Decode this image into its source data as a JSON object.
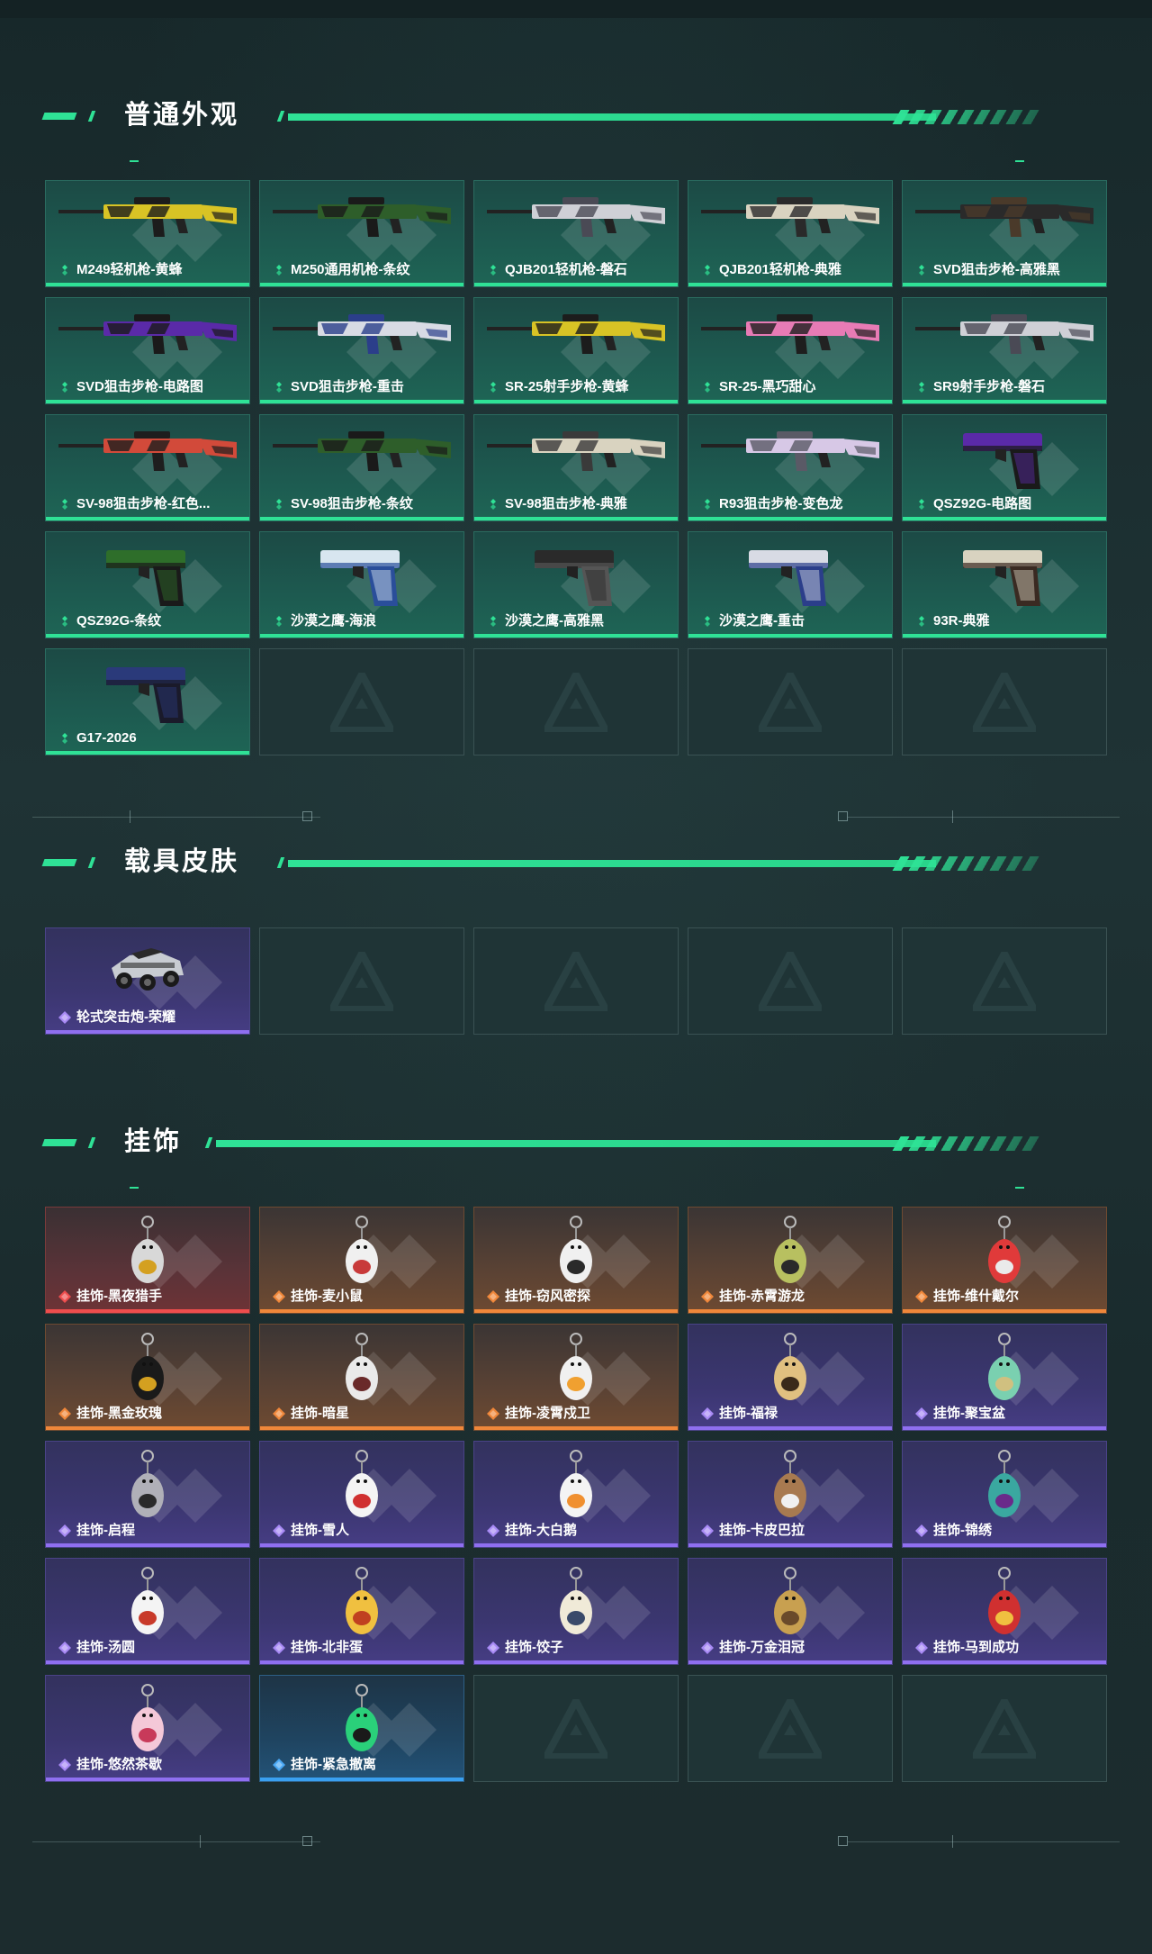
{
  "sections": [
    {
      "title": "普通外观",
      "items": [
        {
          "label": "M249轻机枪-黄蜂",
          "rarity": "green",
          "icon": "light-machine-gun-icon",
          "colors": [
            "#d8c325",
            "#1c1c1c"
          ]
        },
        {
          "label": "M250通用机枪-条纹",
          "rarity": "green",
          "icon": "machine-gun-icon",
          "colors": [
            "#2e5e2a",
            "#1a1a1a"
          ]
        },
        {
          "label": "QJB201轻机枪-磐石",
          "rarity": "green",
          "icon": "light-machine-gun-icon",
          "colors": [
            "#cfd0d6",
            "#4a4a55"
          ]
        },
        {
          "label": "QJB201轻机枪-典雅",
          "rarity": "green",
          "icon": "light-machine-gun-icon",
          "colors": [
            "#d9d3c0",
            "#2a2a2a"
          ]
        },
        {
          "label": "SVD狙击步枪-高雅黑",
          "rarity": "green",
          "icon": "sniper-rifle-icon",
          "colors": [
            "#2a2a2a",
            "#4a3a2a"
          ]
        },
        {
          "label": "SVD狙击步枪-电路图",
          "rarity": "green",
          "icon": "sniper-rifle-icon",
          "colors": [
            "#5a2aa8",
            "#1a1a1a"
          ]
        },
        {
          "label": "SVD狙击步枪-重击",
          "rarity": "green",
          "icon": "sniper-rifle-icon",
          "colors": [
            "#d8dbe4",
            "#2b3e8a"
          ]
        },
        {
          "label": "SR-25射手步枪-黄蜂",
          "rarity": "green",
          "icon": "marksman-rifle-icon",
          "colors": [
            "#d8c325",
            "#1c1c1c"
          ]
        },
        {
          "label": "SR-25-黑巧甜心",
          "rarity": "green",
          "icon": "marksman-rifle-icon",
          "colors": [
            "#e77bb5",
            "#1e1e1e"
          ]
        },
        {
          "label": "SR9射手步枪-磐石",
          "rarity": "green",
          "icon": "marksman-rifle-icon",
          "colors": [
            "#cfd0d6",
            "#4a4a55"
          ]
        },
        {
          "label": "SV-98狙击步枪-红色...",
          "rarity": "green",
          "icon": "sniper-rifle-icon",
          "colors": [
            "#d24a3a",
            "#1e1e1e"
          ]
        },
        {
          "label": "SV-98狙击步枪-条纹",
          "rarity": "green",
          "icon": "sniper-rifle-icon",
          "colors": [
            "#2e5e2a",
            "#1a1a1a"
          ]
        },
        {
          "label": "SV-98狙击步枪-典雅",
          "rarity": "green",
          "icon": "sniper-rifle-icon",
          "colors": [
            "#d9d3c0",
            "#3a3a3a"
          ]
        },
        {
          "label": "R93狙击步枪-变色龙",
          "rarity": "green",
          "icon": "sniper-rifle-icon",
          "colors": [
            "#d7c8e6",
            "#5a5a66"
          ]
        },
        {
          "label": "QSZ92G-电路图",
          "rarity": "green",
          "icon": "pistol-icon",
          "colors": [
            "#5a2aa8",
            "#1a1a1a"
          ]
        },
        {
          "label": "QSZ92G-条纹",
          "rarity": "green",
          "icon": "pistol-icon",
          "colors": [
            "#2e6e2a",
            "#1a1a1a"
          ]
        },
        {
          "label": "沙漠之鹰-海浪",
          "rarity": "green",
          "icon": "pistol-icon",
          "colors": [
            "#d8e6f0",
            "#2a4e9a"
          ]
        },
        {
          "label": "沙漠之鹰-高雅黑",
          "rarity": "green",
          "icon": "pistol-icon",
          "colors": [
            "#2a2a2a",
            "#555555"
          ]
        },
        {
          "label": "沙漠之鹰-重击",
          "rarity": "green",
          "icon": "pistol-icon",
          "colors": [
            "#d8dbe4",
            "#2b3e8a"
          ]
        },
        {
          "label": "93R-典雅",
          "rarity": "green",
          "icon": "pistol-icon",
          "colors": [
            "#d9d3c0",
            "#3a2a22"
          ]
        },
        {
          "label": "G17-2026",
          "rarity": "green",
          "icon": "pistol-icon",
          "colors": [
            "#2a3a7a",
            "#1a1a2a"
          ]
        },
        {
          "label": "",
          "rarity": "empty"
        },
        {
          "label": "",
          "rarity": "empty"
        },
        {
          "label": "",
          "rarity": "empty"
        },
        {
          "label": "",
          "rarity": "empty"
        }
      ]
    },
    {
      "title": "载具皮肤",
      "items": [
        {
          "label": "轮式突击炮-荣耀",
          "rarity": "purple",
          "icon": "armored-vehicle-icon",
          "colors": [
            "#c8ccd2",
            "#2a2a2a"
          ]
        },
        {
          "label": "",
          "rarity": "empty"
        },
        {
          "label": "",
          "rarity": "empty"
        },
        {
          "label": "",
          "rarity": "empty"
        },
        {
          "label": "",
          "rarity": "empty"
        }
      ]
    },
    {
      "title": "挂饰",
      "items": [
        {
          "label": "挂饰-黑夜猎手",
          "rarity": "red",
          "icon": "charm-figure-icon",
          "colors": [
            "#d8d8d8",
            "#d4a020"
          ]
        },
        {
          "label": "挂饰-麦小鼠",
          "rarity": "orange",
          "icon": "charm-mouse-icon",
          "colors": [
            "#f0f0f0",
            "#c83a3a"
          ]
        },
        {
          "label": "挂饰-窃风密探",
          "rarity": "orange",
          "icon": "charm-figure-icon",
          "colors": [
            "#f0f0f0",
            "#2a2a2a"
          ]
        },
        {
          "label": "挂饰-赤霄游龙",
          "rarity": "orange",
          "icon": "charm-figure-icon",
          "colors": [
            "#b8c060",
            "#2a2a2a"
          ]
        },
        {
          "label": "挂饰-维什戴尔",
          "rarity": "orange",
          "icon": "charm-figure-icon",
          "colors": [
            "#e03a3a",
            "#eaeaea"
          ]
        },
        {
          "label": "挂饰-黑金玫瑰",
          "rarity": "orange",
          "icon": "charm-rose-icon",
          "colors": [
            "#1a1a1a",
            "#d4a020"
          ]
        },
        {
          "label": "挂饰-暗星",
          "rarity": "orange",
          "icon": "charm-figure-icon",
          "colors": [
            "#eaeaea",
            "#6a2a2a"
          ]
        },
        {
          "label": "挂饰-凌霄戍卫",
          "rarity": "orange",
          "icon": "charm-figure-icon",
          "colors": [
            "#f0f0f0",
            "#f0a030"
          ]
        },
        {
          "label": "挂饰-福禄",
          "rarity": "purple",
          "icon": "charm-gourd-icon",
          "colors": [
            "#e0c080",
            "#3a2a1a"
          ]
        },
        {
          "label": "挂饰-聚宝盆",
          "rarity": "purple",
          "icon": "charm-treasure-icon",
          "colors": [
            "#7ad0b0",
            "#d0c080"
          ]
        },
        {
          "label": "挂饰-启程",
          "rarity": "purple",
          "icon": "charm-ring-icon",
          "colors": [
            "#b0b0b8",
            "#2a2a2a"
          ]
        },
        {
          "label": "挂饰-雪人",
          "rarity": "purple",
          "icon": "charm-snowman-icon",
          "colors": [
            "#f4f4f4",
            "#d03030"
          ]
        },
        {
          "label": "挂饰-大白鹅",
          "rarity": "purple",
          "icon": "charm-goose-icon",
          "colors": [
            "#f4f4f4",
            "#f09030"
          ]
        },
        {
          "label": "挂饰-卡皮巴拉",
          "rarity": "purple",
          "icon": "charm-capybara-icon",
          "colors": [
            "#a87a50",
            "#f0f0f0"
          ]
        },
        {
          "label": "挂饰-锦绣",
          "rarity": "purple",
          "icon": "charm-butterfly-icon",
          "colors": [
            "#3aa8a0",
            "#6a2a8a"
          ]
        },
        {
          "label": "挂饰-汤圆",
          "rarity": "purple",
          "icon": "charm-bowl-icon",
          "colors": [
            "#f4f4f4",
            "#c83a2a"
          ]
        },
        {
          "label": "挂饰-北非蛋",
          "rarity": "purple",
          "icon": "charm-bowl-icon",
          "colors": [
            "#f0c040",
            "#c04020"
          ]
        },
        {
          "label": "挂饰-饺子",
          "rarity": "purple",
          "icon": "charm-plate-icon",
          "colors": [
            "#f0ead8",
            "#3a4a6a"
          ]
        },
        {
          "label": "挂饰-万金泪冠",
          "rarity": "purple",
          "icon": "charm-burger-icon",
          "colors": [
            "#c8a050",
            "#6a4a2a"
          ]
        },
        {
          "label": "挂饰-马到成功",
          "rarity": "purple",
          "icon": "charm-horse-icon",
          "colors": [
            "#d03030",
            "#f0c040"
          ]
        },
        {
          "label": "挂饰-悠然茶歇",
          "rarity": "purple",
          "icon": "charm-cupcake-icon",
          "colors": [
            "#f4c8d8",
            "#c83a5a"
          ]
        },
        {
          "label": "挂饰-紧急撤离",
          "rarity": "blue",
          "icon": "charm-device-icon",
          "colors": [
            "#2ad07a",
            "#1a1a1a"
          ]
        },
        {
          "label": "",
          "rarity": "empty"
        },
        {
          "label": "",
          "rarity": "empty"
        },
        {
          "label": "",
          "rarity": "empty"
        }
      ]
    }
  ]
}
